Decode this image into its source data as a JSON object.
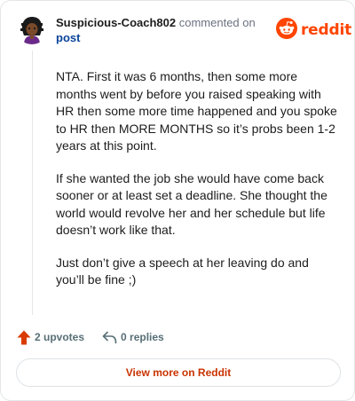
{
  "header": {
    "username": "Suspicious-Coach802",
    "action_text": "commented on",
    "post_link": "post",
    "brand": "reddit"
  },
  "comment": {
    "paragraphs": [
      "NTA. First it was 6 months, then some more months went by before you raised speaking with HR then some more time happened and you spoke to HR then MORE MONTHS so it’s probs been 1-2 years at this point.",
      "If she wanted the job she would have come back sooner or at least set a deadline. She thought the world would revolve her and her schedule but life doesn’t work like that.",
      "Just don’t give a speech at her leaving do and you’ll be fine ;)"
    ]
  },
  "actions": {
    "upvotes": "2 upvotes",
    "replies": "0 replies"
  },
  "footer": {
    "view_more": "View more on Reddit"
  },
  "colors": {
    "brand": "#ff4500",
    "link": "#0a449b",
    "view_more_text": "#c93300",
    "muted": "#576f76"
  },
  "icons": [
    "avatar",
    "reddit-snoo-icon",
    "upvote-arrow-icon",
    "reply-arrow-icon"
  ]
}
